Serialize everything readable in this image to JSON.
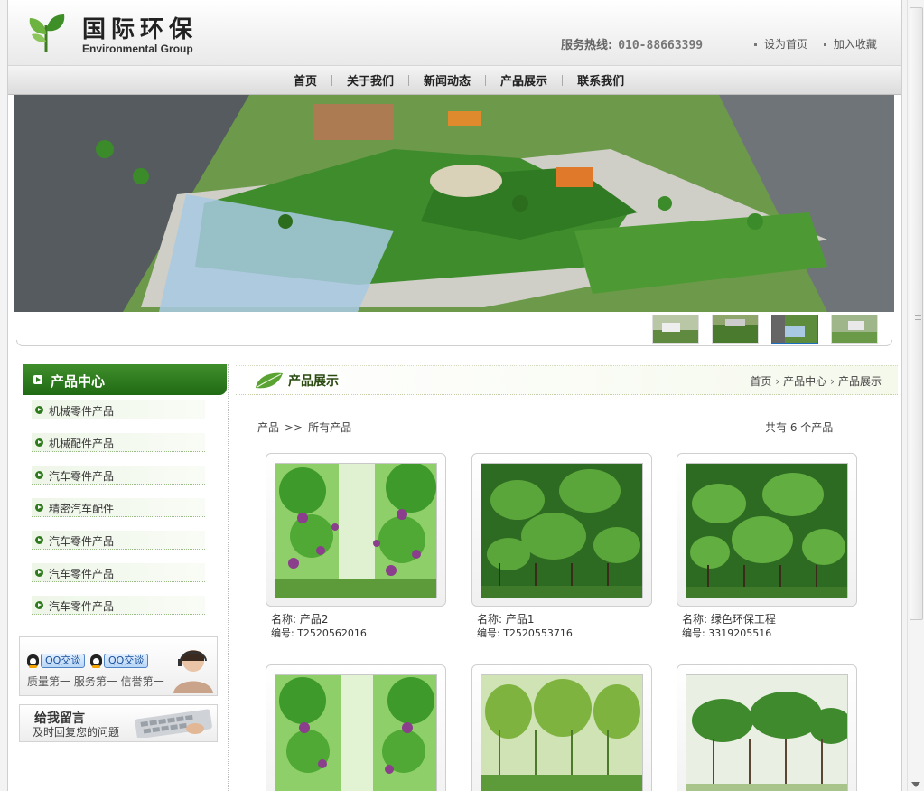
{
  "header": {
    "logo_cn": "国际环保",
    "logo_en": "Environmental Group",
    "hotline_label": "服务热线:",
    "hotline_number": "010-88663399",
    "links": [
      "设为首页",
      "加入收藏"
    ]
  },
  "nav": {
    "items": [
      "首页",
      "关于我们",
      "新闻动态",
      "产品展示",
      "联系我们"
    ]
  },
  "banner": {
    "thumbnails_count_active": 3
  },
  "sidebar": {
    "title": "产品中心",
    "items": [
      "机械零件产品",
      "机械配件产品",
      "汽车零件产品",
      "精密汽车配件",
      "汽车零件产品",
      "汽车零件产品",
      "汽车零件产品"
    ],
    "qq_buttons": [
      "QQ交谈",
      "QQ交谈"
    ],
    "slogan": "质量第一 服务第一 信誉第一",
    "message_title": "给我留言",
    "message_sub": "及时回复您的问题"
  },
  "main": {
    "title": "产品展示",
    "breadcrumb": [
      "首页",
      "产品中心",
      "产品展示"
    ],
    "list_path": [
      "产品",
      ">>",
      "所有产品"
    ],
    "count_text": "共有 6 个产品",
    "products": [
      {
        "name": "名称: 产品2",
        "code": "编号: T2520562016"
      },
      {
        "name": "名称: 产品1",
        "code": "编号: T2520553716"
      },
      {
        "name": "名称: 绿色环保工程",
        "code": "编号: 3319205516"
      },
      {
        "name": "",
        "code": ""
      },
      {
        "name": "",
        "code": ""
      },
      {
        "name": "",
        "code": ""
      }
    ]
  },
  "colors": {
    "accent_green": "#2e7b1f",
    "nav_bg": "#e0e0e0"
  }
}
